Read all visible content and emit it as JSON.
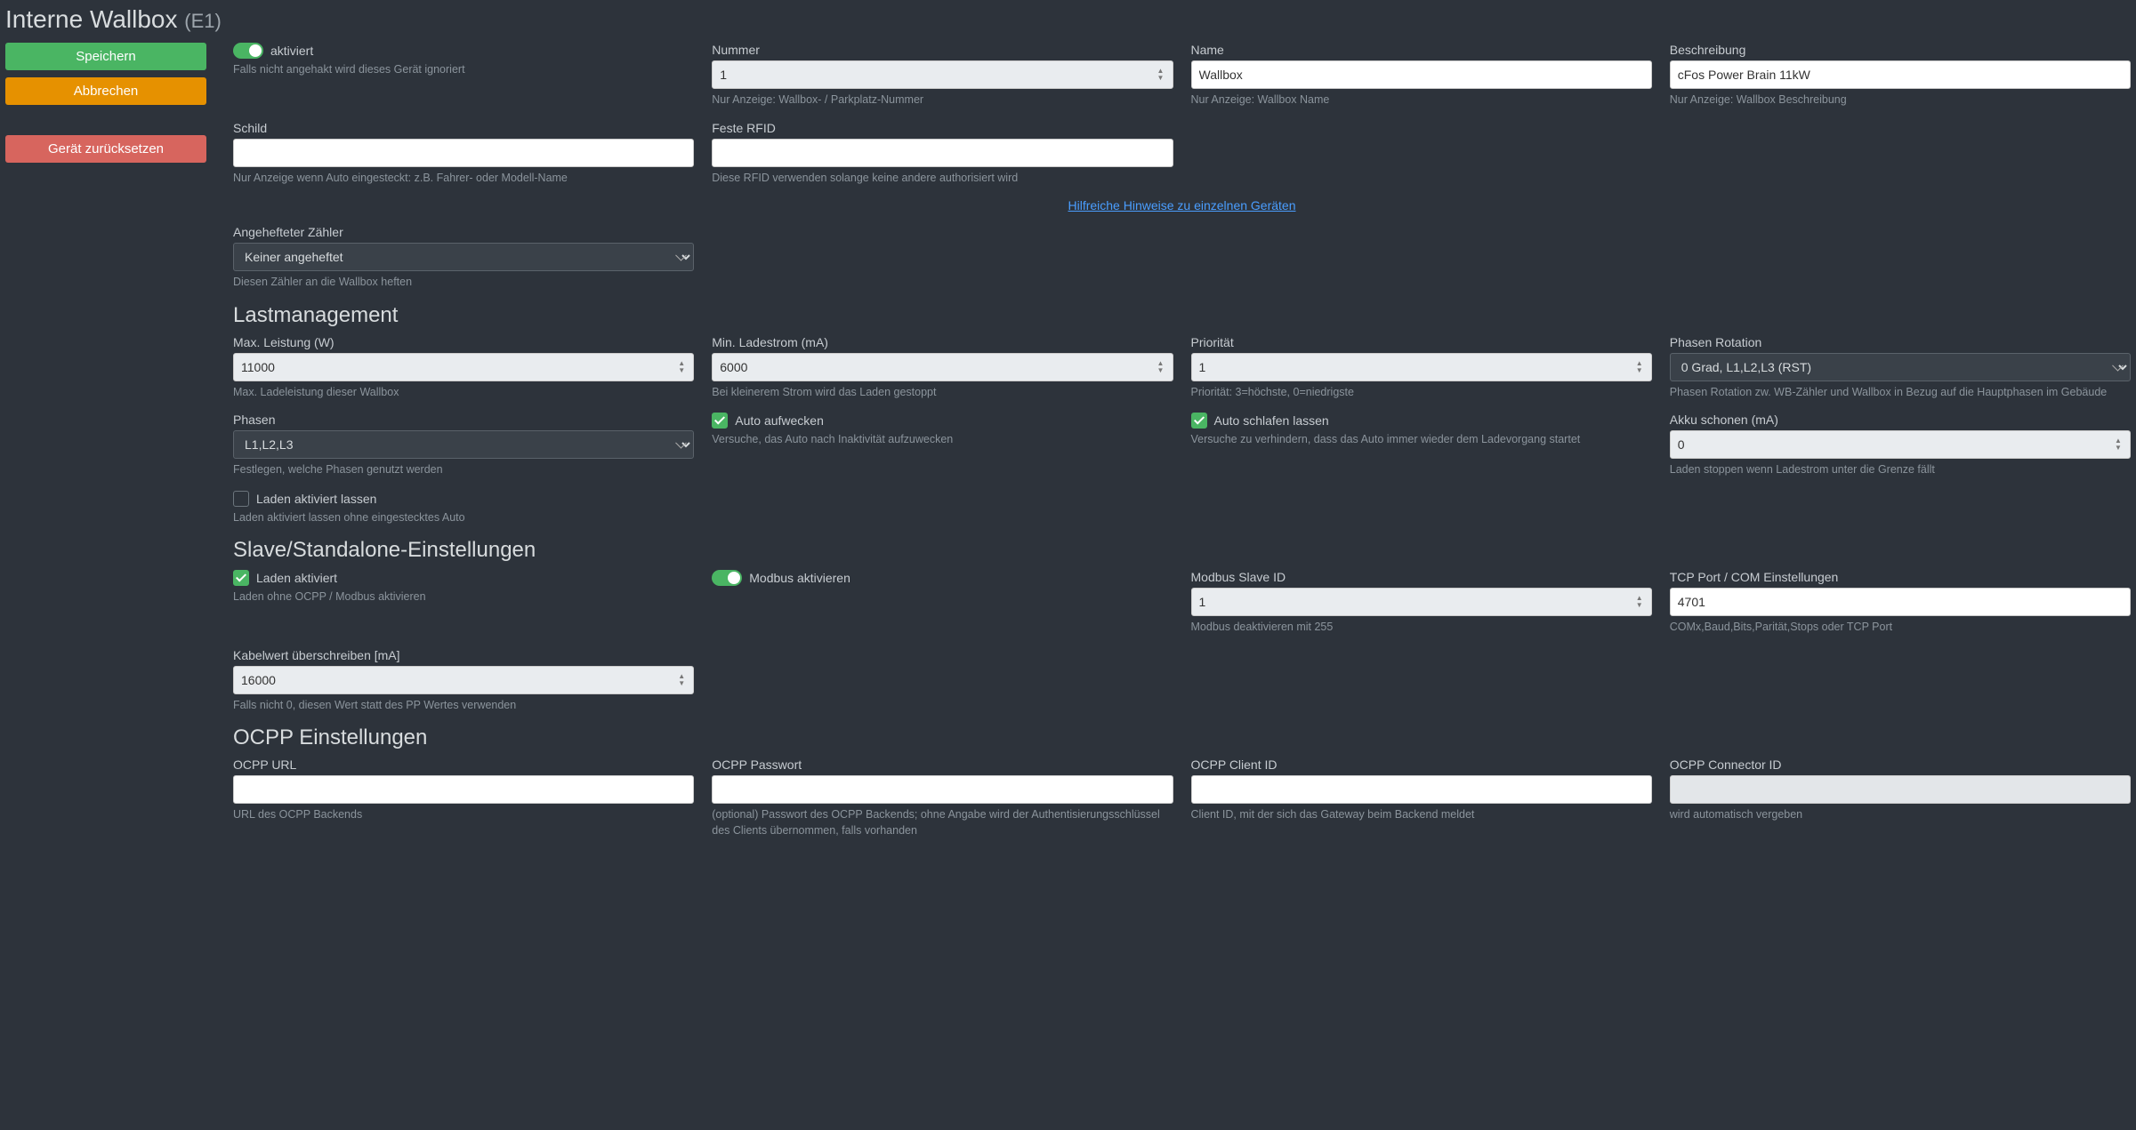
{
  "header": {
    "title": "Interne Wallbox",
    "sub": "(E1)"
  },
  "sidebar": {
    "save": "Speichern",
    "cancel": "Abbrechen",
    "reset": "Gerät zurücksetzen"
  },
  "activated": {
    "label": "aktiviert",
    "hint": "Falls nicht angehakt wird dieses Gerät ignoriert"
  },
  "number": {
    "label": "Nummer",
    "value": "1",
    "hint": "Nur Anzeige: Wallbox- / Parkplatz-Nummer"
  },
  "name": {
    "label": "Name",
    "value": "Wallbox",
    "hint": "Nur Anzeige: Wallbox Name"
  },
  "description": {
    "label": "Beschreibung",
    "value": "cFos Power Brain 11kW",
    "hint": "Nur Anzeige: Wallbox Beschreibung"
  },
  "schild": {
    "label": "Schild",
    "value": "",
    "hint": "Nur Anzeige wenn Auto eingesteckt: z.B. Fahrer- oder Modell-Name"
  },
  "feste_rfid": {
    "label": "Feste RFID",
    "value": "",
    "hint": "Diese RFID verwenden solange keine andere authorisiert wird"
  },
  "hints_link": "Hilfreiche Hinweise zu einzelnen Geräten",
  "attached_meter": {
    "label": "Angehefteter Zähler",
    "value": "Keiner angeheftet",
    "hint": "Diesen Zähler an die Wallbox heften"
  },
  "section_load": "Lastmanagement",
  "max_power": {
    "label": "Max. Leistung (W)",
    "value": "11000",
    "hint": "Max. Ladeleistung dieser Wallbox"
  },
  "min_current": {
    "label": "Min. Ladestrom (mA)",
    "value": "6000",
    "hint": "Bei kleinerem Strom wird das Laden gestoppt"
  },
  "priority": {
    "label": "Priorität",
    "value": "1",
    "hint": "Priorität: 3=höchste, 0=niedrigste"
  },
  "phase_rot": {
    "label": "Phasen Rotation",
    "value": "0 Grad, L1,L2,L3 (RST)",
    "hint": "Phasen Rotation zw. WB-Zähler und Wallbox in Bezug auf die Hauptphasen im Gebäude"
  },
  "phases": {
    "label": "Phasen",
    "value": "L1,L2,L3",
    "hint": "Festlegen, welche Phasen genutzt werden"
  },
  "auto_wake": {
    "label": "Auto aufwecken",
    "hint": "Versuche, das Auto nach Inaktivität aufzuwecken"
  },
  "auto_sleep": {
    "label": "Auto schlafen lassen",
    "hint": "Versuche zu verhindern, dass das Auto immer wieder dem Ladevorgang startet"
  },
  "battery_save": {
    "label": "Akku schonen (mA)",
    "value": "0",
    "hint": "Laden stoppen wenn Ladestrom unter die Grenze fällt"
  },
  "keep_charge": {
    "label": "Laden aktiviert lassen",
    "hint": "Laden aktiviert lassen ohne eingestecktes Auto"
  },
  "section_slave": "Slave/Standalone-Einstellungen",
  "charge_enabled": {
    "label": "Laden aktiviert",
    "hint": "Laden ohne OCPP / Modbus aktivieren"
  },
  "modbus_enable": {
    "label": "Modbus aktivieren"
  },
  "modbus_id": {
    "label": "Modbus Slave ID",
    "value": "1",
    "hint": "Modbus deaktivieren mit 255"
  },
  "tcp_port": {
    "label": "TCP Port / COM Einstellungen",
    "value": "4701",
    "hint": "COMx,Baud,Bits,Parität,Stops oder TCP Port"
  },
  "cable_override": {
    "label": "Kabelwert überschreiben [mA]",
    "value": "16000",
    "hint": "Falls nicht 0, diesen Wert statt des PP Wertes verwenden"
  },
  "section_ocpp": "OCPP Einstellungen",
  "ocpp_url": {
    "label": "OCPP URL",
    "value": "",
    "hint": "URL des OCPP Backends"
  },
  "ocpp_pass": {
    "label": "OCPP Passwort",
    "value": "",
    "hint": "(optional) Passwort des OCPP Backends; ohne Angabe wird der Authentisierungsschlüssel des Clients übernommen, falls vorhanden"
  },
  "ocpp_client": {
    "label": "OCPP Client ID",
    "value": "",
    "hint": "Client ID, mit der sich das Gateway beim Backend meldet"
  },
  "ocpp_conn": {
    "label": "OCPP Connector ID",
    "value": "",
    "hint": "wird automatisch vergeben"
  }
}
